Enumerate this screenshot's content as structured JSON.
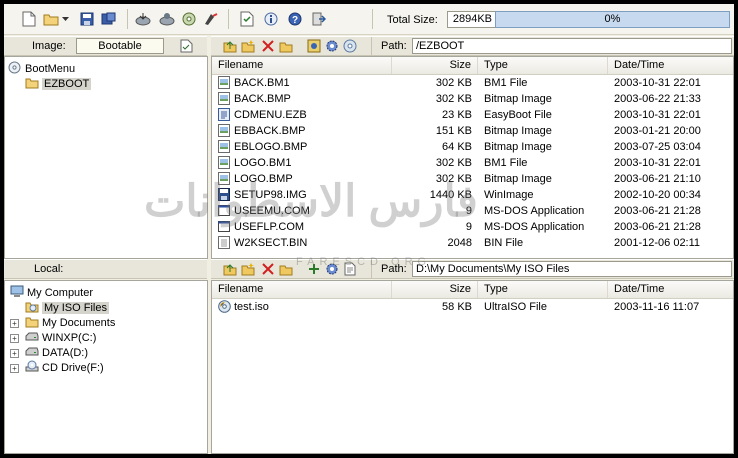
{
  "toolbar": {
    "buttons": [
      "new-icon",
      "open-icon",
      "dropdown-icon",
      "save-icon",
      "save-as-icon",
      "extract-icon",
      "properties-icon",
      "mount-icon",
      "burn-icon",
      "checksum-icon",
      "info-icon",
      "help-icon",
      "exit-icon"
    ],
    "total_size_label": "Total Size:",
    "total_size_value": "2894KB",
    "progress_text": "0%",
    "progress_fraction": 0
  },
  "image_bar": {
    "label": "Image:",
    "image_type": "Bootable",
    "path_label": "Path:",
    "path": "/EZBOOT"
  },
  "image_tree": {
    "root": "BootMenu",
    "child": "EZBOOT"
  },
  "image_list": {
    "columns": [
      "Filename",
      "Size",
      "Type",
      "Date/Time"
    ],
    "rows": [
      {
        "name": "BACK.BM1",
        "size": "302 KB",
        "type": "BM1 File",
        "date": "2003-10-31 22:01",
        "icon": "bmp-file-icon"
      },
      {
        "name": "BACK.BMP",
        "size": "302 KB",
        "type": "Bitmap Image",
        "date": "2003-06-22 21:33",
        "icon": "bmp-file-icon"
      },
      {
        "name": "CDMENU.EZB",
        "size": "23 KB",
        "type": "EasyBoot File",
        "date": "2003-10-31 22:01",
        "icon": "ezb-file-icon"
      },
      {
        "name": "EBBACK.BMP",
        "size": "151 KB",
        "type": "Bitmap Image",
        "date": "2003-01-21 20:00",
        "icon": "bmp-file-icon"
      },
      {
        "name": "EBLOGO.BMP",
        "size": "64 KB",
        "type": "Bitmap Image",
        "date": "2003-07-25 03:04",
        "icon": "bmp-file-icon"
      },
      {
        "name": "LOGO.BM1",
        "size": "302 KB",
        "type": "BM1 File",
        "date": "2003-10-31 22:01",
        "icon": "bmp-file-icon"
      },
      {
        "name": "LOGO.BMP",
        "size": "302 KB",
        "type": "Bitmap Image",
        "date": "2003-06-21 21:10",
        "icon": "bmp-file-icon"
      },
      {
        "name": "SETUP98.IMG",
        "size": "1440 KB",
        "type": "WinImage",
        "date": "2002-10-20 00:34",
        "icon": "floppy-image-icon"
      },
      {
        "name": "USEEMU.COM",
        "size": "9",
        "type": "MS-DOS Application",
        "date": "2003-06-21 21:28",
        "icon": "dos-app-icon"
      },
      {
        "name": "USEFLP.COM",
        "size": "9",
        "type": "MS-DOS Application",
        "date": "2003-06-21 21:28",
        "icon": "dos-app-icon"
      },
      {
        "name": "W2KSECT.BIN",
        "size": "2048",
        "type": "BIN File",
        "date": "2001-12-06 02:11",
        "icon": "bin-file-icon"
      }
    ]
  },
  "local_bar": {
    "label": "Local:",
    "path_label": "Path:",
    "path": "D:\\My Documents\\My ISO Files"
  },
  "local_tree": {
    "items": [
      {
        "label": "My Computer",
        "icon": "computer-icon",
        "level": 0,
        "expander": ""
      },
      {
        "label": "My ISO Files",
        "icon": "cd-folder-icon",
        "level": 1,
        "expander": "",
        "selected": true
      },
      {
        "label": "My Documents",
        "icon": "folder-icon",
        "level": 1,
        "expander": "+"
      },
      {
        "label": "WINXP(C:)",
        "icon": "drive-icon",
        "level": 1,
        "expander": "+"
      },
      {
        "label": "DATA(D:)",
        "icon": "drive-icon",
        "level": 1,
        "expander": "+"
      },
      {
        "label": "CD Drive(F:)",
        "icon": "cd-drive-icon",
        "level": 1,
        "expander": "+"
      }
    ]
  },
  "local_list": {
    "columns": [
      "Filename",
      "Size",
      "Type",
      "Date/Time"
    ],
    "rows": [
      {
        "name": "test.iso",
        "size": "58 KB",
        "type": "UltraISO File",
        "date": "2003-11-16 11:07",
        "icon": "iso-file-icon"
      }
    ]
  },
  "watermark": {
    "text": "فارس الاسطوانات",
    "subtext": "FARESCD.ORG"
  }
}
